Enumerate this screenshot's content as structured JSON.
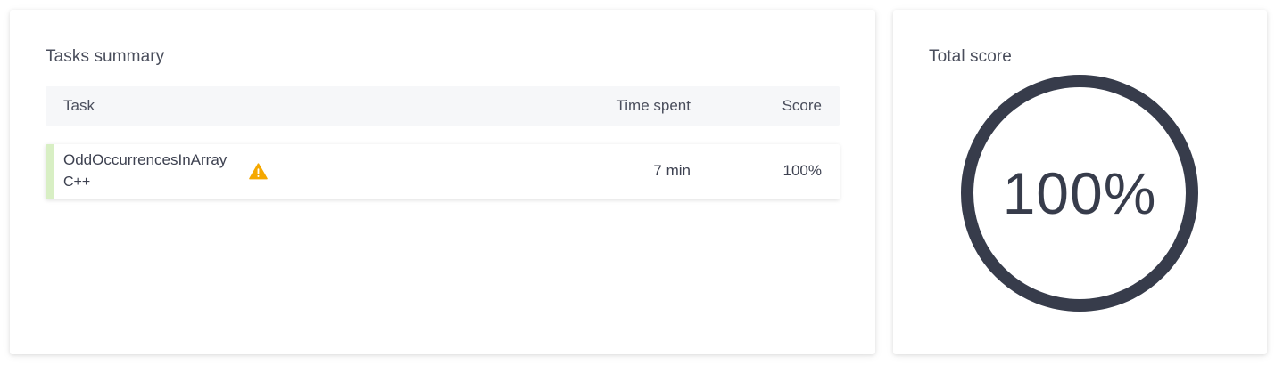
{
  "tasks_summary": {
    "title": "Tasks summary",
    "columns": {
      "task": "Task",
      "time_spent": "Time spent",
      "score": "Score"
    },
    "rows": [
      {
        "name": "OddOccurrencesInArray",
        "language": "C++",
        "time_spent": "7 min",
        "score": "100%",
        "status_icon": "warning-icon",
        "accent_color": "#d8efc4"
      }
    ]
  },
  "total_score": {
    "title": "Total score",
    "value_text": "100%",
    "value": 1.0,
    "ring_color": "#373c4b"
  },
  "colors": {
    "warning": "#f5a800",
    "text": "#3d4150",
    "header_bg": "#f6f7f9"
  }
}
